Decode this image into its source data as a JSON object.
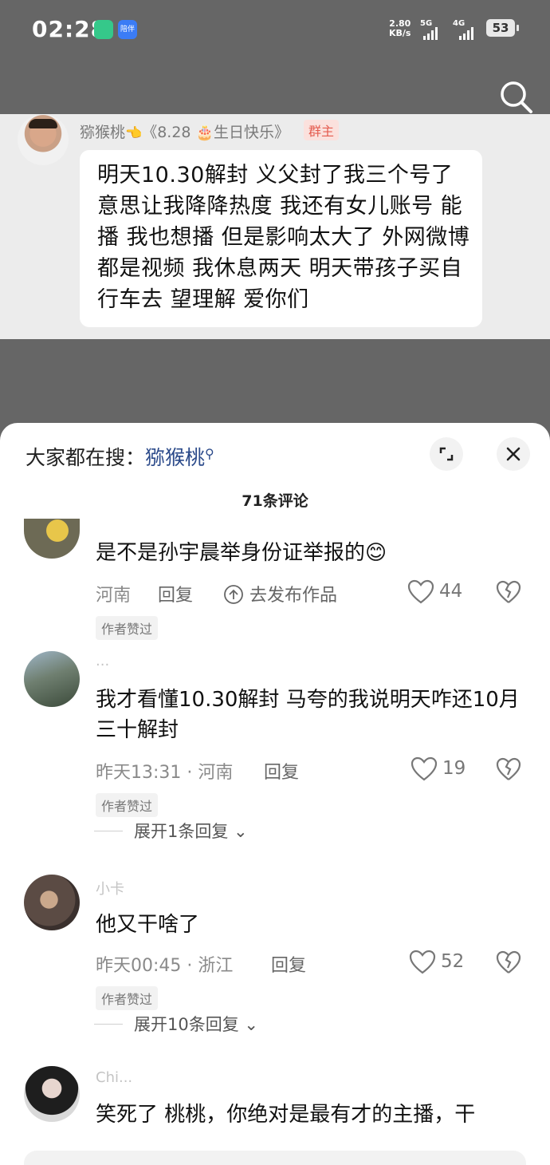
{
  "status_bar": {
    "time": "02:28",
    "app_icon_label": "陪伴",
    "net_speed_value": "2.80",
    "net_speed_unit": "KB/s",
    "sig1_label": "5G",
    "sig2_label": "4G",
    "battery": "53"
  },
  "chat": {
    "sender_name": "猕猴桃",
    "sender_suffix": "《8.28",
    "sender_suffix2": "生日快乐》",
    "role_badge": "群主",
    "message": "明天10.30解封  义父封了我三个号了 意思让我降降热度 我还有女儿账号 能播 我也想播 但是影响太大了 外网微博都是视频 我休息两天 明天带孩子买自行车去 望理解 爱你们"
  },
  "sheet": {
    "hot_search_prefix": "大家都在搜：",
    "hot_search_keyword": "猕猴桃",
    "comment_count": "71条评论"
  },
  "comments": [
    {
      "name": "",
      "text": "是不是孙宇晨举身份证举报的😊",
      "meta": "河南",
      "reply": "回复",
      "post_works": "去发布作品",
      "likes": "44",
      "tag": "作者赞过"
    },
    {
      "name": "...",
      "text": "我才看懂10.30解封 马夸的我说明天咋还10月三十解封",
      "meta": "昨天13:31 · 河南",
      "reply": "回复",
      "likes": "19",
      "tag": "作者赞过",
      "expand": "展开1条回复"
    },
    {
      "name": "小卡",
      "text": "他又干啥了",
      "meta": "昨天00:45 · 浙江",
      "reply": "回复",
      "likes": "52",
      "tag": "作者赞过",
      "expand": "展开10条回复"
    },
    {
      "name": "Chi...",
      "text": "笑死了 桃桃，你绝对是最有才的主播，干",
      "meta": "",
      "likes": ""
    }
  ],
  "colors": {
    "dim_background": "#666666",
    "chat_background": "#ececec",
    "keyword": "#2b4a8a",
    "badge_text": "#e45c4f"
  }
}
